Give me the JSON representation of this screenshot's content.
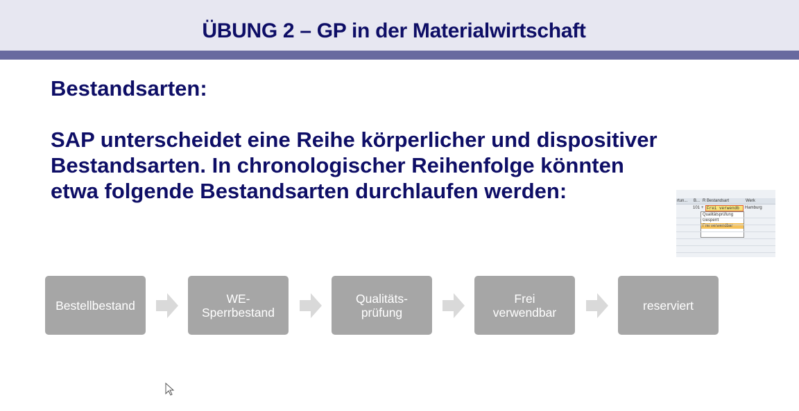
{
  "slide": {
    "title": "ÜBUNG 2 – GP in der Materialwirtschaft",
    "heading": "Bestandsarten:",
    "paragraph_lines": [
      "SAP unterscheidet eine Reihe körperlicher und dispositiver",
      "Bestandsarten. In chronologischer Reihenfolge könnten",
      "etwa folgende Bestandsarten durchlaufen werden:"
    ],
    "colors": {
      "title": "#0e0e66",
      "header_bg": "#e7e7f1",
      "header_bar": "#686a9f",
      "box": "#a6a6a6",
      "arrow": "#d9d9d9"
    }
  },
  "sap_screenshot": {
    "columns": [
      "rtun...",
      "B...",
      "R",
      "Bestandsart",
      "Werk"
    ],
    "row": {
      "col2": "101",
      "col3": "+",
      "bestandsart": "Frei verwendb",
      "werk": "Hamburg"
    },
    "options": [
      "Qualitätsprüfung",
      "Gesperrt",
      "Frei verwendbar"
    ],
    "selected_option": "Frei verwendbar"
  },
  "process": [
    {
      "label": "Bestellbestand"
    },
    {
      "label": "WE-\nSperrbestand"
    },
    {
      "label": "Qualitäts-\nprüfung"
    },
    {
      "label": "Frei\nverwendbar"
    },
    {
      "label": "reserviert"
    }
  ]
}
